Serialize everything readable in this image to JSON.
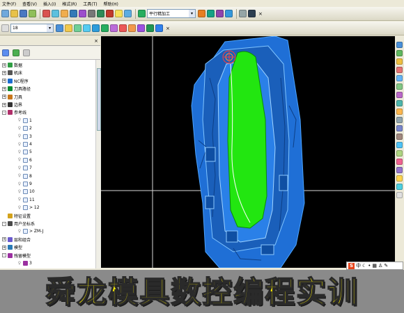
{
  "menu": {
    "items": [
      "文件(F)",
      "查看(V)",
      "插入(I)",
      "格式(R)",
      "工具(T)",
      "帮助(H)"
    ]
  },
  "toolbar1": {
    "operation_combo": "平行精加工"
  },
  "toolbar2": {
    "font_size": "18"
  },
  "nav": {
    "close": "×"
  },
  "tree": [
    {
      "label": "数据",
      "depth": 0,
      "exp": "+",
      "icon": "#2f9e44"
    },
    {
      "label": "机床",
      "depth": 0,
      "exp": "+",
      "icon": "#555"
    },
    {
      "label": "NC程序",
      "depth": 0,
      "exp": "+",
      "icon": "#1c6dd0"
    },
    {
      "label": "刀具路径",
      "depth": 0,
      "exp": "+",
      "icon": "#0b8a2f"
    },
    {
      "label": "刀具",
      "depth": 0,
      "exp": "+",
      "icon": "#c7761b"
    },
    {
      "label": "边界",
      "depth": 0,
      "exp": "+",
      "icon": "#333"
    },
    {
      "label": "参考线",
      "depth": 0,
      "exp": "-",
      "icon": "#b0306a"
    },
    {
      "label": "1",
      "depth": 1,
      "exp": "",
      "icon": ""
    },
    {
      "label": "2",
      "depth": 1,
      "exp": "",
      "icon": ""
    },
    {
      "label": "3",
      "depth": 1,
      "exp": "",
      "icon": ""
    },
    {
      "label": "4",
      "depth": 1,
      "exp": "",
      "icon": ""
    },
    {
      "label": "5",
      "depth": 1,
      "exp": "",
      "icon": ""
    },
    {
      "label": "6",
      "depth": 1,
      "exp": "",
      "icon": ""
    },
    {
      "label": "7",
      "depth": 1,
      "exp": "",
      "icon": ""
    },
    {
      "label": "8",
      "depth": 1,
      "exp": "",
      "icon": ""
    },
    {
      "label": "9",
      "depth": 1,
      "exp": "",
      "icon": ""
    },
    {
      "label": "10",
      "depth": 1,
      "exp": "",
      "icon": ""
    },
    {
      "label": "11",
      "depth": 1,
      "exp": "",
      "icon": ""
    },
    {
      "label": "> 12",
      "depth": 1,
      "exp": "",
      "icon": ""
    },
    {
      "label": "特征设置",
      "depth": 0,
      "exp": "",
      "icon": "#d3a21b"
    },
    {
      "label": "用户坐标系",
      "depth": 0,
      "exp": "-",
      "icon": "#4a4a4a"
    },
    {
      "label": "> ZM-J",
      "depth": 1,
      "exp": "",
      "icon": ""
    },
    {
      "label": "层和组合",
      "depth": 0,
      "exp": "+",
      "icon": "#6a5acd"
    },
    {
      "label": "模型",
      "depth": 0,
      "exp": "+",
      "icon": "#2a7ab5"
    },
    {
      "label": "残留模型",
      "depth": 0,
      "exp": "-",
      "icon": "#9b30a0"
    },
    {
      "label": "3",
      "depth": 1,
      "exp": "",
      "icon": "#9b30a0"
    }
  ],
  "ime": {
    "logo": "S",
    "lang": "中"
  },
  "banner": {
    "text": "舜龙模具数控编程实训"
  },
  "colors": {
    "viewport": "#000000",
    "model": "#1f6fd6",
    "surface": "#22e610",
    "banner_text": "#fff200"
  }
}
